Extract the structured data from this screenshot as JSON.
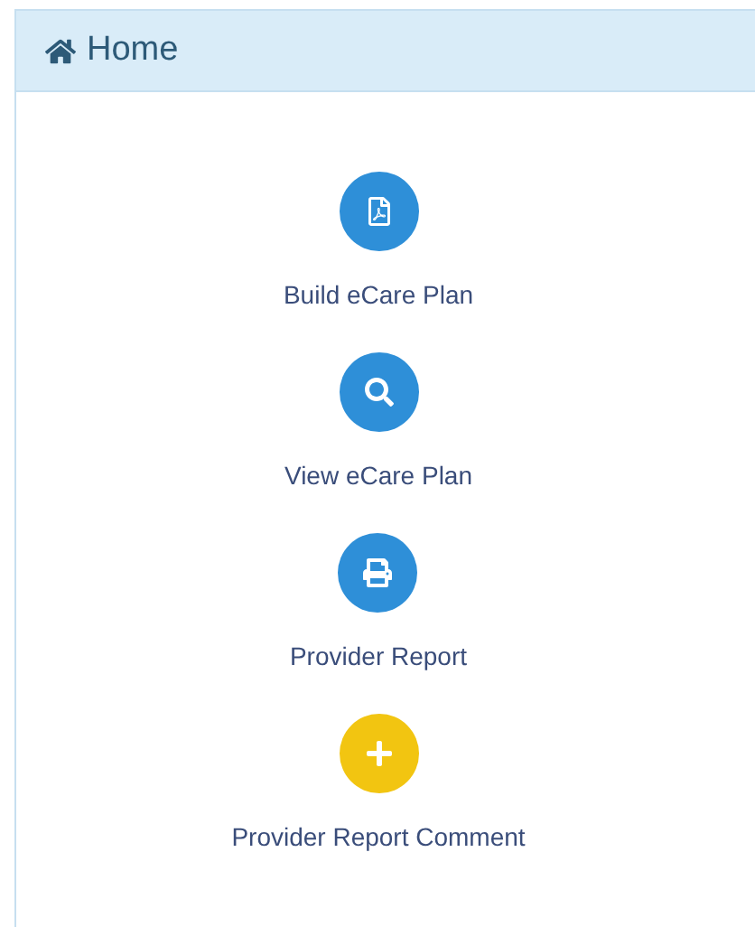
{
  "panel": {
    "title": "Home"
  },
  "actions": [
    {
      "kind": "pdf",
      "label": "Build eCare Plan",
      "color": "#2e8fd8"
    },
    {
      "kind": "search",
      "label": "View eCare Plan",
      "color": "#2e8fd8"
    },
    {
      "kind": "print",
      "label": "Provider Report",
      "color": "#2e8fd8"
    },
    {
      "kind": "plus",
      "label": "Provider Report Comment",
      "color": "#f2c511"
    }
  ]
}
